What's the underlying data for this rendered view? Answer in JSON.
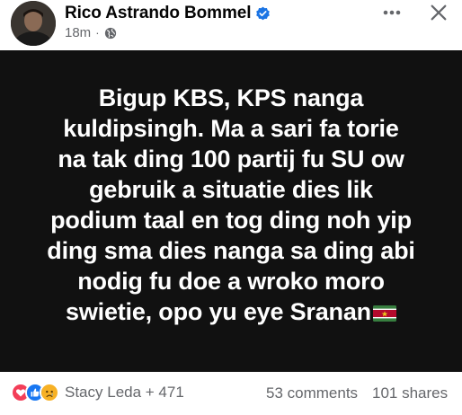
{
  "post": {
    "author": {
      "name": "Rico Astrando Bommel",
      "verified": true,
      "avatar_icon": "profile-photo"
    },
    "meta": {
      "timestamp": "18m",
      "separator": "·",
      "audience_icon": "globe-icon"
    },
    "actions": {
      "more_icon": "more-horizontal-icon",
      "more_label": "•••",
      "close_icon": "close-icon"
    },
    "card": {
      "background": "#111111",
      "text_color": "#ffffff",
      "text": "Bigup KBS, KPS nanga\nkuldipsingh. Ma a sari fa torie\nna tak ding 100 partij fu SU ow\ngebruik a situatie dies lik\npodium taal en tog ding noh yip\nding sma dies nanga sa ding abi\nnodig fu doe a wroko moro\nswietie, opo yu eye Sranan",
      "trailing_emoji": "flag-suriname"
    }
  },
  "footer": {
    "reactions": [
      "love-reaction-icon",
      "like-reaction-icon",
      "sad-reaction-icon"
    ],
    "reaction_summary": "Stacy Leda + 471",
    "comments": "53 comments",
    "shares": "101 shares"
  },
  "colors": {
    "verified_blue": "#1b74e4",
    "secondary_text": "#65676b",
    "like_blue": "#1877f2",
    "love_red": "#f33e58",
    "sad_yellow": "#f7b125"
  }
}
